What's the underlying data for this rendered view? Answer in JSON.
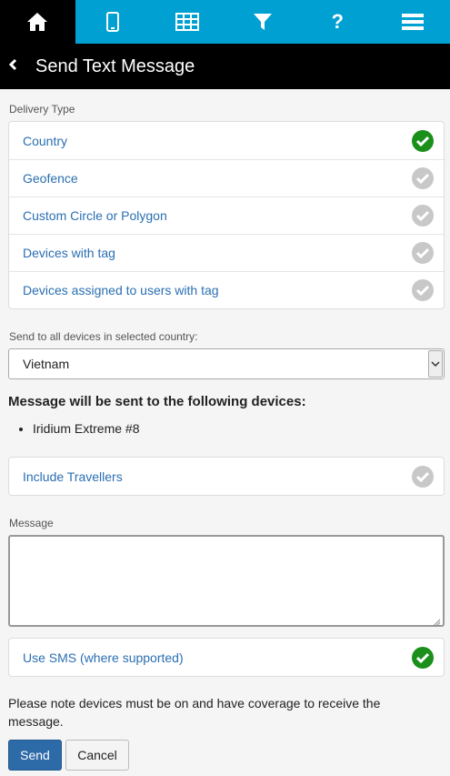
{
  "nav": {
    "tabs": [
      {
        "icon": "home-icon",
        "active": true
      },
      {
        "icon": "device-icon",
        "active": false
      },
      {
        "icon": "grid-icon",
        "active": false
      },
      {
        "icon": "filter-icon",
        "active": false
      },
      {
        "icon": "help-icon",
        "active": false
      },
      {
        "icon": "menu-icon",
        "active": false
      }
    ]
  },
  "header": {
    "title": "Send Text Message"
  },
  "delivery": {
    "label": "Delivery Type",
    "options": [
      {
        "label": "Country",
        "selected": true
      },
      {
        "label": "Geofence",
        "selected": false
      },
      {
        "label": "Custom Circle or Polygon",
        "selected": false
      },
      {
        "label": "Devices with tag",
        "selected": false
      },
      {
        "label": "Devices assigned to users with tag",
        "selected": false
      }
    ]
  },
  "country": {
    "label": "Send to all devices in selected country:",
    "selected": "Vietnam"
  },
  "devices": {
    "heading": "Message will be sent to the following devices:",
    "items": [
      "Iridium Extreme #8"
    ]
  },
  "travellers": {
    "label": "Include Travellers",
    "selected": false
  },
  "message": {
    "label": "Message",
    "value": ""
  },
  "sms": {
    "label": "Use SMS (where supported)",
    "selected": true
  },
  "note": "Please note devices must be on and have coverage to receive the message.",
  "buttons": {
    "send": "Send",
    "cancel": "Cancel"
  },
  "colors": {
    "nav_bg": "#00a0d2",
    "link": "#2a6fb3",
    "check_on": "#1a8f1a",
    "check_off": "#c8c8c8",
    "primary": "#2d6aa8"
  }
}
